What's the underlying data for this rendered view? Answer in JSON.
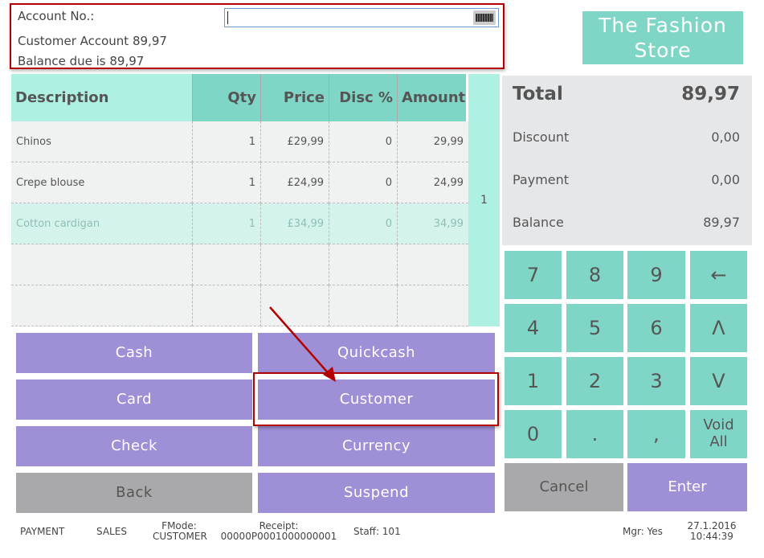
{
  "account": {
    "label": "Account No.:",
    "value": "",
    "line1": "Customer Account 89,97",
    "line2": "Balance due is 89,97"
  },
  "logo": {
    "line1": "The Fashion",
    "line2": "Store"
  },
  "table": {
    "headers": [
      "Description",
      "Qty",
      "Price",
      "Disc %",
      "Amount"
    ],
    "rows": [
      [
        "Chinos",
        "1",
        "£29,99",
        "0",
        "29,99"
      ],
      [
        "Crepe blouse",
        "1",
        "£24,99",
        "0",
        "24,99"
      ],
      [
        "Cotton cardigan",
        "1",
        "£34,99",
        "0",
        "34,99"
      ]
    ],
    "side_count": "1"
  },
  "totals": {
    "total_label": "Total",
    "total": "89,97",
    "discount_label": "Discount",
    "discount": "0,00",
    "payment_label": "Payment",
    "payment": "0,00",
    "balance_label": "Balance",
    "balance": "89,97"
  },
  "payments": [
    "Cash",
    "Quickcash",
    "Card",
    "Customer",
    "Check",
    "Currency",
    "Back",
    "Suspend"
  ],
  "keypad": [
    "7",
    "8",
    "9",
    "←",
    "4",
    "5",
    "6",
    "Λ",
    "1",
    "2",
    "3",
    "V",
    "0",
    ".",
    ",",
    "Void All"
  ],
  "actions": {
    "cancel": "Cancel",
    "enter": "Enter"
  },
  "status": {
    "mode": "PAYMENT",
    "sales": "SALES",
    "fmode_label": "FMode:",
    "fmode": "CUSTOMER",
    "receipt_label": "Receipt:",
    "receipt": "00000P0001000000001",
    "staff": "Staff: 101",
    "mgr": "Mgr: Yes",
    "date": "27.1.2016",
    "time": "10:44:39"
  },
  "colors": {
    "teal": "#80d6c6",
    "light_teal": "#aef0e2",
    "purple": "#9e8fd6",
    "highlight": "#b40000"
  }
}
